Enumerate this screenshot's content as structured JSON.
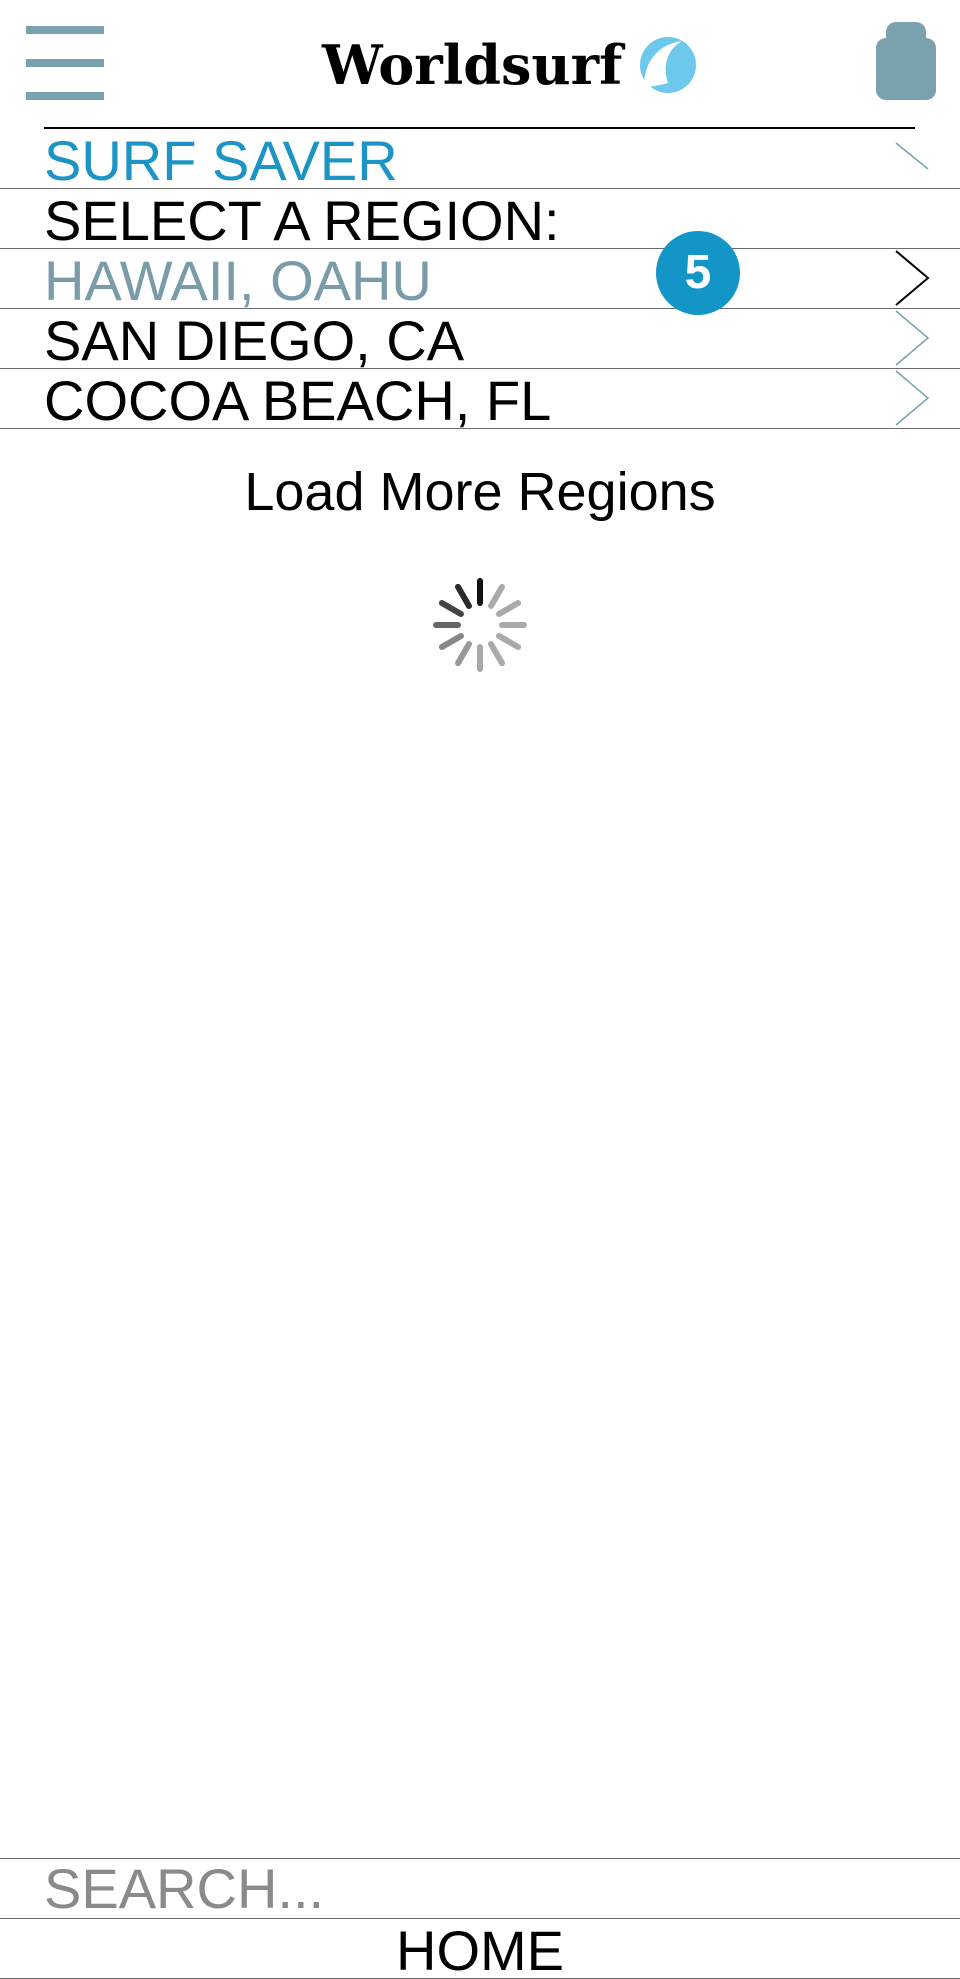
{
  "header": {
    "brand_name": "Worldsurf",
    "menu_icon": "hamburger-menu-icon",
    "brand_icon": "wave-icon",
    "user_icon": "user-icon",
    "icon_color": "#7aa1ad",
    "wave_color": "#6cc8ec"
  },
  "section": {
    "surf_saver_label": "SURF SAVER",
    "select_region_label": "SELECT A REGION:"
  },
  "regions": [
    {
      "label": "HAWAII, OAHU",
      "selected": true
    },
    {
      "label": "SAN DIEGO, CA",
      "selected": false
    },
    {
      "label": "COCOA BEACH, FL",
      "selected": false
    }
  ],
  "badge": {
    "count": "5",
    "color": "#1495c8"
  },
  "load_more_label": "Load More Regions",
  "spinner_icon": "loading-spinner-icon",
  "search": {
    "placeholder": "SEARCH..."
  },
  "footer": {
    "home_label": "HOME"
  },
  "colors": {
    "accent": "#1c94c4",
    "selected_text": "#7a9ca8"
  }
}
